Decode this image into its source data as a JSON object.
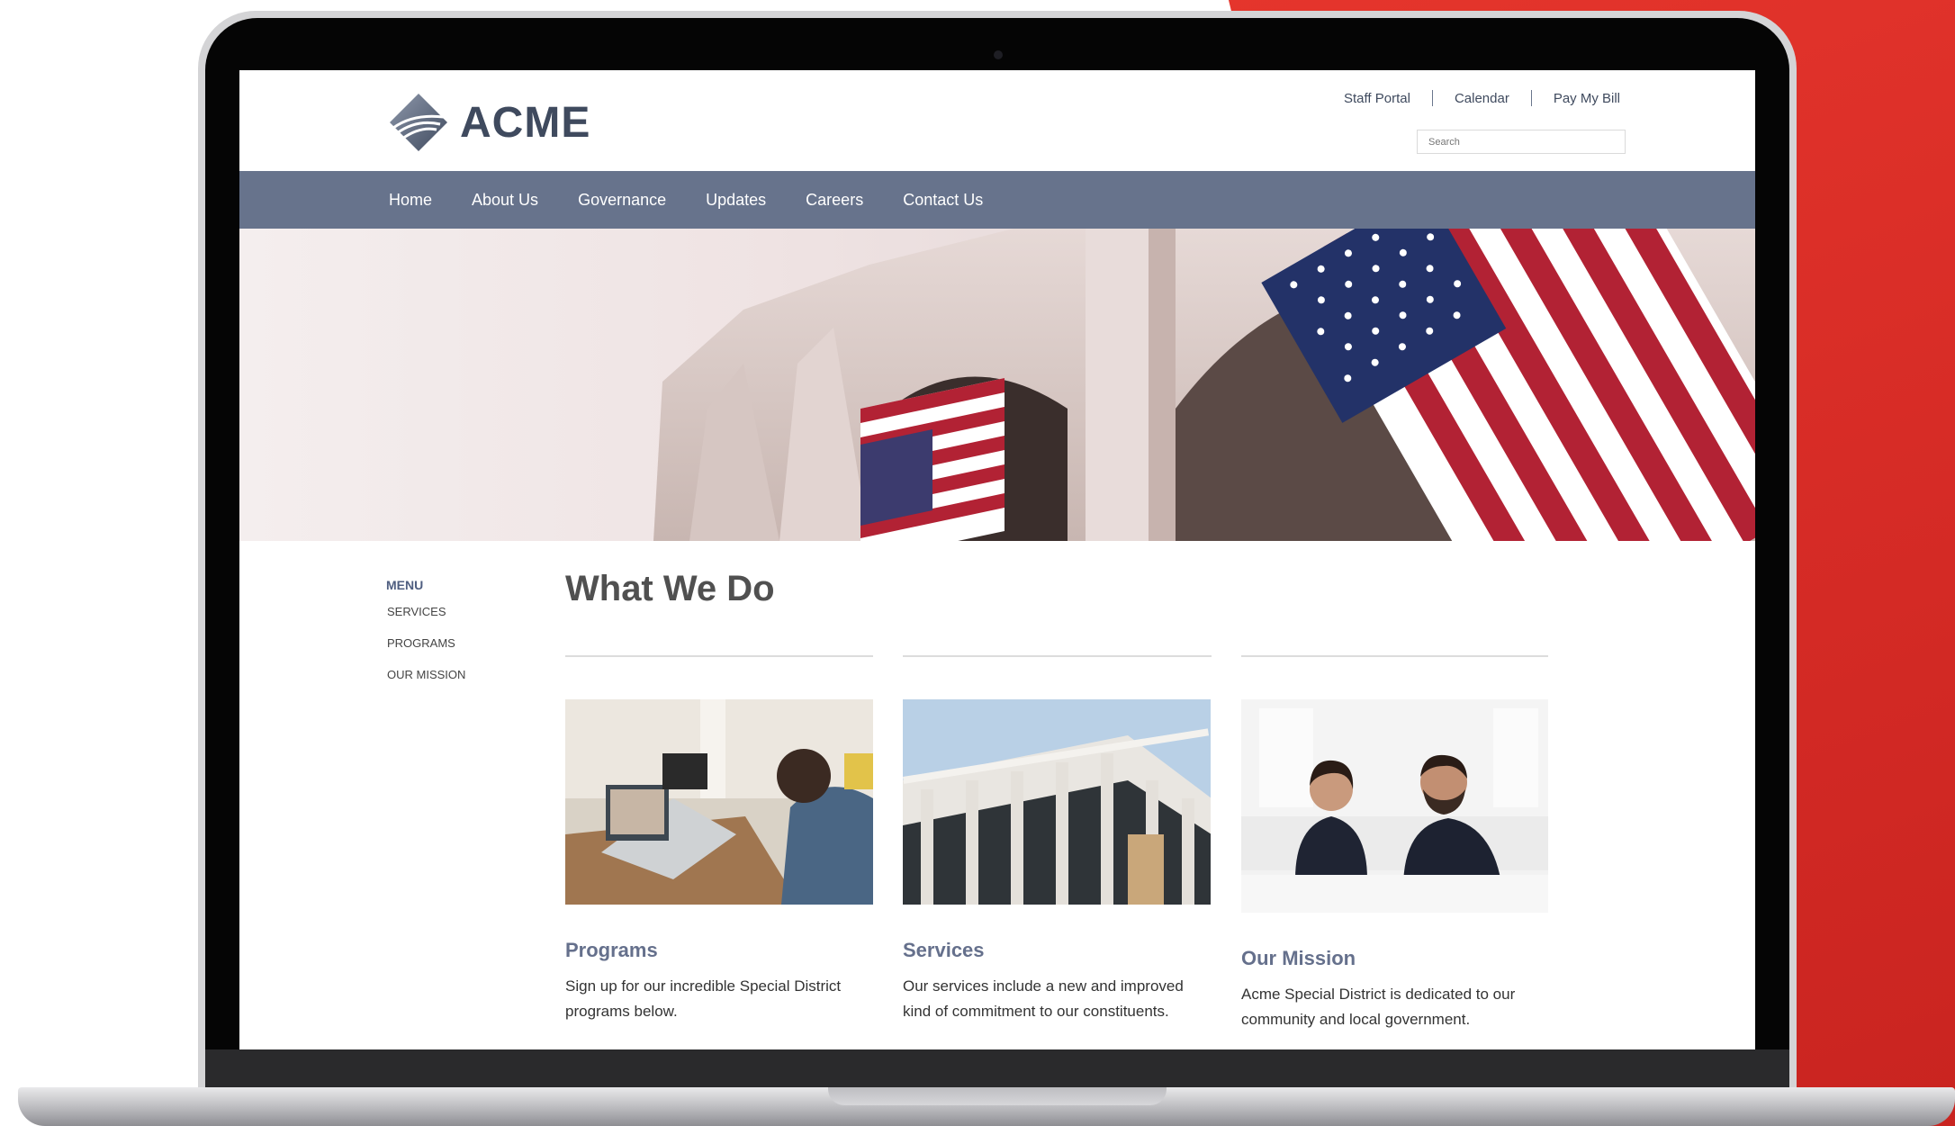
{
  "brand": {
    "name": "ACME"
  },
  "utility_links": [
    {
      "label": "Staff Portal"
    },
    {
      "label": "Calendar"
    },
    {
      "label": "Pay My Bill"
    }
  ],
  "search": {
    "placeholder": "Search"
  },
  "nav": [
    {
      "label": "Home"
    },
    {
      "label": "About Us"
    },
    {
      "label": "Governance"
    },
    {
      "label": "Updates"
    },
    {
      "label": "Careers"
    },
    {
      "label": "Contact Us"
    }
  ],
  "sidebar": {
    "title": "MENU",
    "items": [
      {
        "label": "SERVICES"
      },
      {
        "label": "PROGRAMS"
      },
      {
        "label": "OUR MISSION"
      }
    ]
  },
  "main": {
    "heading": "What We Do",
    "cards": [
      {
        "title": "Programs",
        "text": "Sign up for our incredible Special District programs below."
      },
      {
        "title": "Services",
        "text": "Our services include a new and improved kind of commitment to our constituents."
      },
      {
        "title": "Our Mission",
        "text": "Acme Special District is dedicated to our community and local government."
      }
    ]
  },
  "colors": {
    "nav_background": "#67738c",
    "brand_text": "#3f4a5e",
    "card_title": "#65708c",
    "backdrop_red": "#d42a25"
  },
  "icons": [
    "acme-logo-icon"
  ]
}
